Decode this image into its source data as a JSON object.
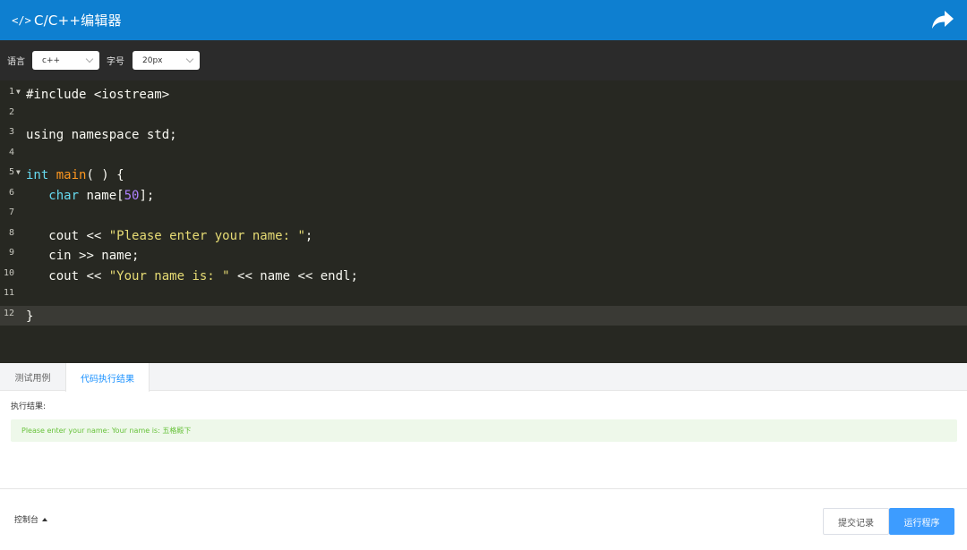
{
  "header": {
    "icon": "code-icon",
    "code_glyph": "</>",
    "title": "C/C++编辑器",
    "share_icon": "share-icon",
    "bg_color": "#0e7fd0"
  },
  "toolbar": {
    "language_label": "语言",
    "language_value": "c++",
    "font_size_label": "字号",
    "font_size_value": "20px"
  },
  "editor": {
    "theme": "monokai",
    "active_line": 12,
    "lines": [
      {
        "num": "1",
        "fold": true
      },
      {
        "num": "2",
        "fold": false
      },
      {
        "num": "3",
        "fold": false
      },
      {
        "num": "4",
        "fold": false
      },
      {
        "num": "5",
        "fold": true
      },
      {
        "num": "6",
        "fold": false
      },
      {
        "num": "7",
        "fold": false
      },
      {
        "num": "8",
        "fold": false
      },
      {
        "num": "9",
        "fold": false
      },
      {
        "num": "10",
        "fold": false
      },
      {
        "num": "11",
        "fold": false
      },
      {
        "num": "12",
        "fold": false
      }
    ],
    "code": {
      "l1": "#include <iostream>",
      "l3": "using namespace std;",
      "l5_kw": "int",
      "l5_fn": "main",
      "l5_rest": "( ) {",
      "l6_kw": "char",
      "l6_a": " name[",
      "l6_num": "50",
      "l6_b": "];",
      "l8_a": "cout << ",
      "l8_str": "\"Please enter your name: \"",
      "l8_b": ";",
      "l9": "cin >> name;",
      "l10_a": "cout << ",
      "l10_str": "\"Your name is: \"",
      "l10_b": " << name << endl;",
      "l12": "}"
    }
  },
  "result": {
    "tabs": [
      {
        "label": "测试用例",
        "active": false
      },
      {
        "label": "代码执行结果",
        "active": true
      }
    ],
    "label": "执行结果:",
    "output": "Please enter your name: Your name is: 五格殿下"
  },
  "footer": {
    "console_label": "控制台",
    "history_button": "提交记录",
    "run_button": "运行程序"
  }
}
